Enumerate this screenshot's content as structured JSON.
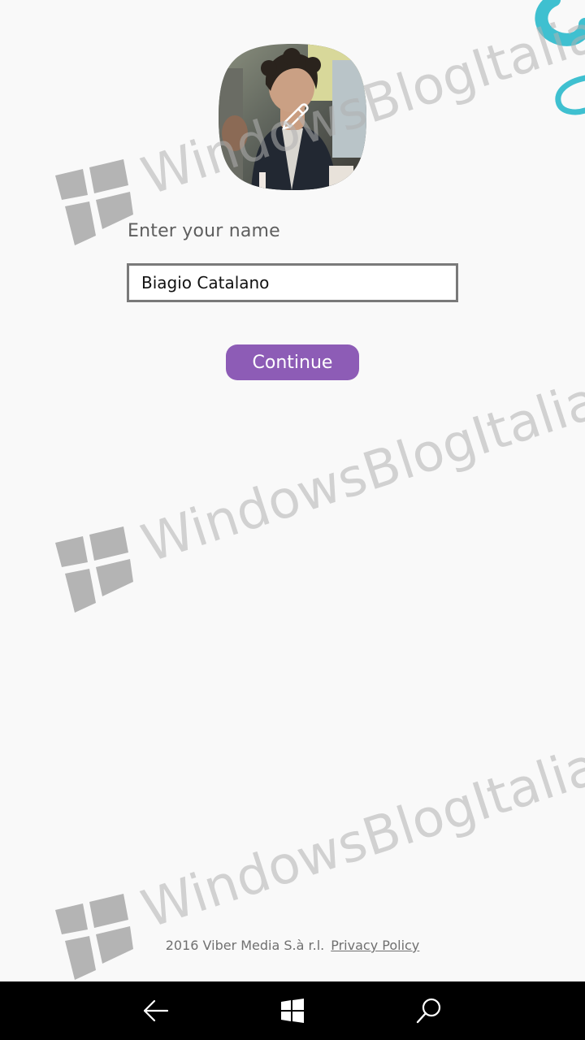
{
  "profile": {
    "photo_icon": "profile-photo-avatar",
    "edit_icon": "pencil-icon"
  },
  "form": {
    "name_label": "Enter your name",
    "name_value": "Biagio Catalano",
    "continue_label": "Continue"
  },
  "footer": {
    "copyright": "2016  Viber Media S.à r.l.",
    "privacy_label": "Privacy Policy"
  },
  "watermark": {
    "text": "WindowsBlogItalia"
  },
  "navbar": {
    "back_icon": "back-arrow-icon",
    "home_icon": "windows-logo-icon",
    "search_icon": "search-icon"
  },
  "colors": {
    "accent": "#8d5cb6",
    "background": "#f9f9f9",
    "swirl": "#3fc0d0",
    "navbar": "#000000"
  }
}
